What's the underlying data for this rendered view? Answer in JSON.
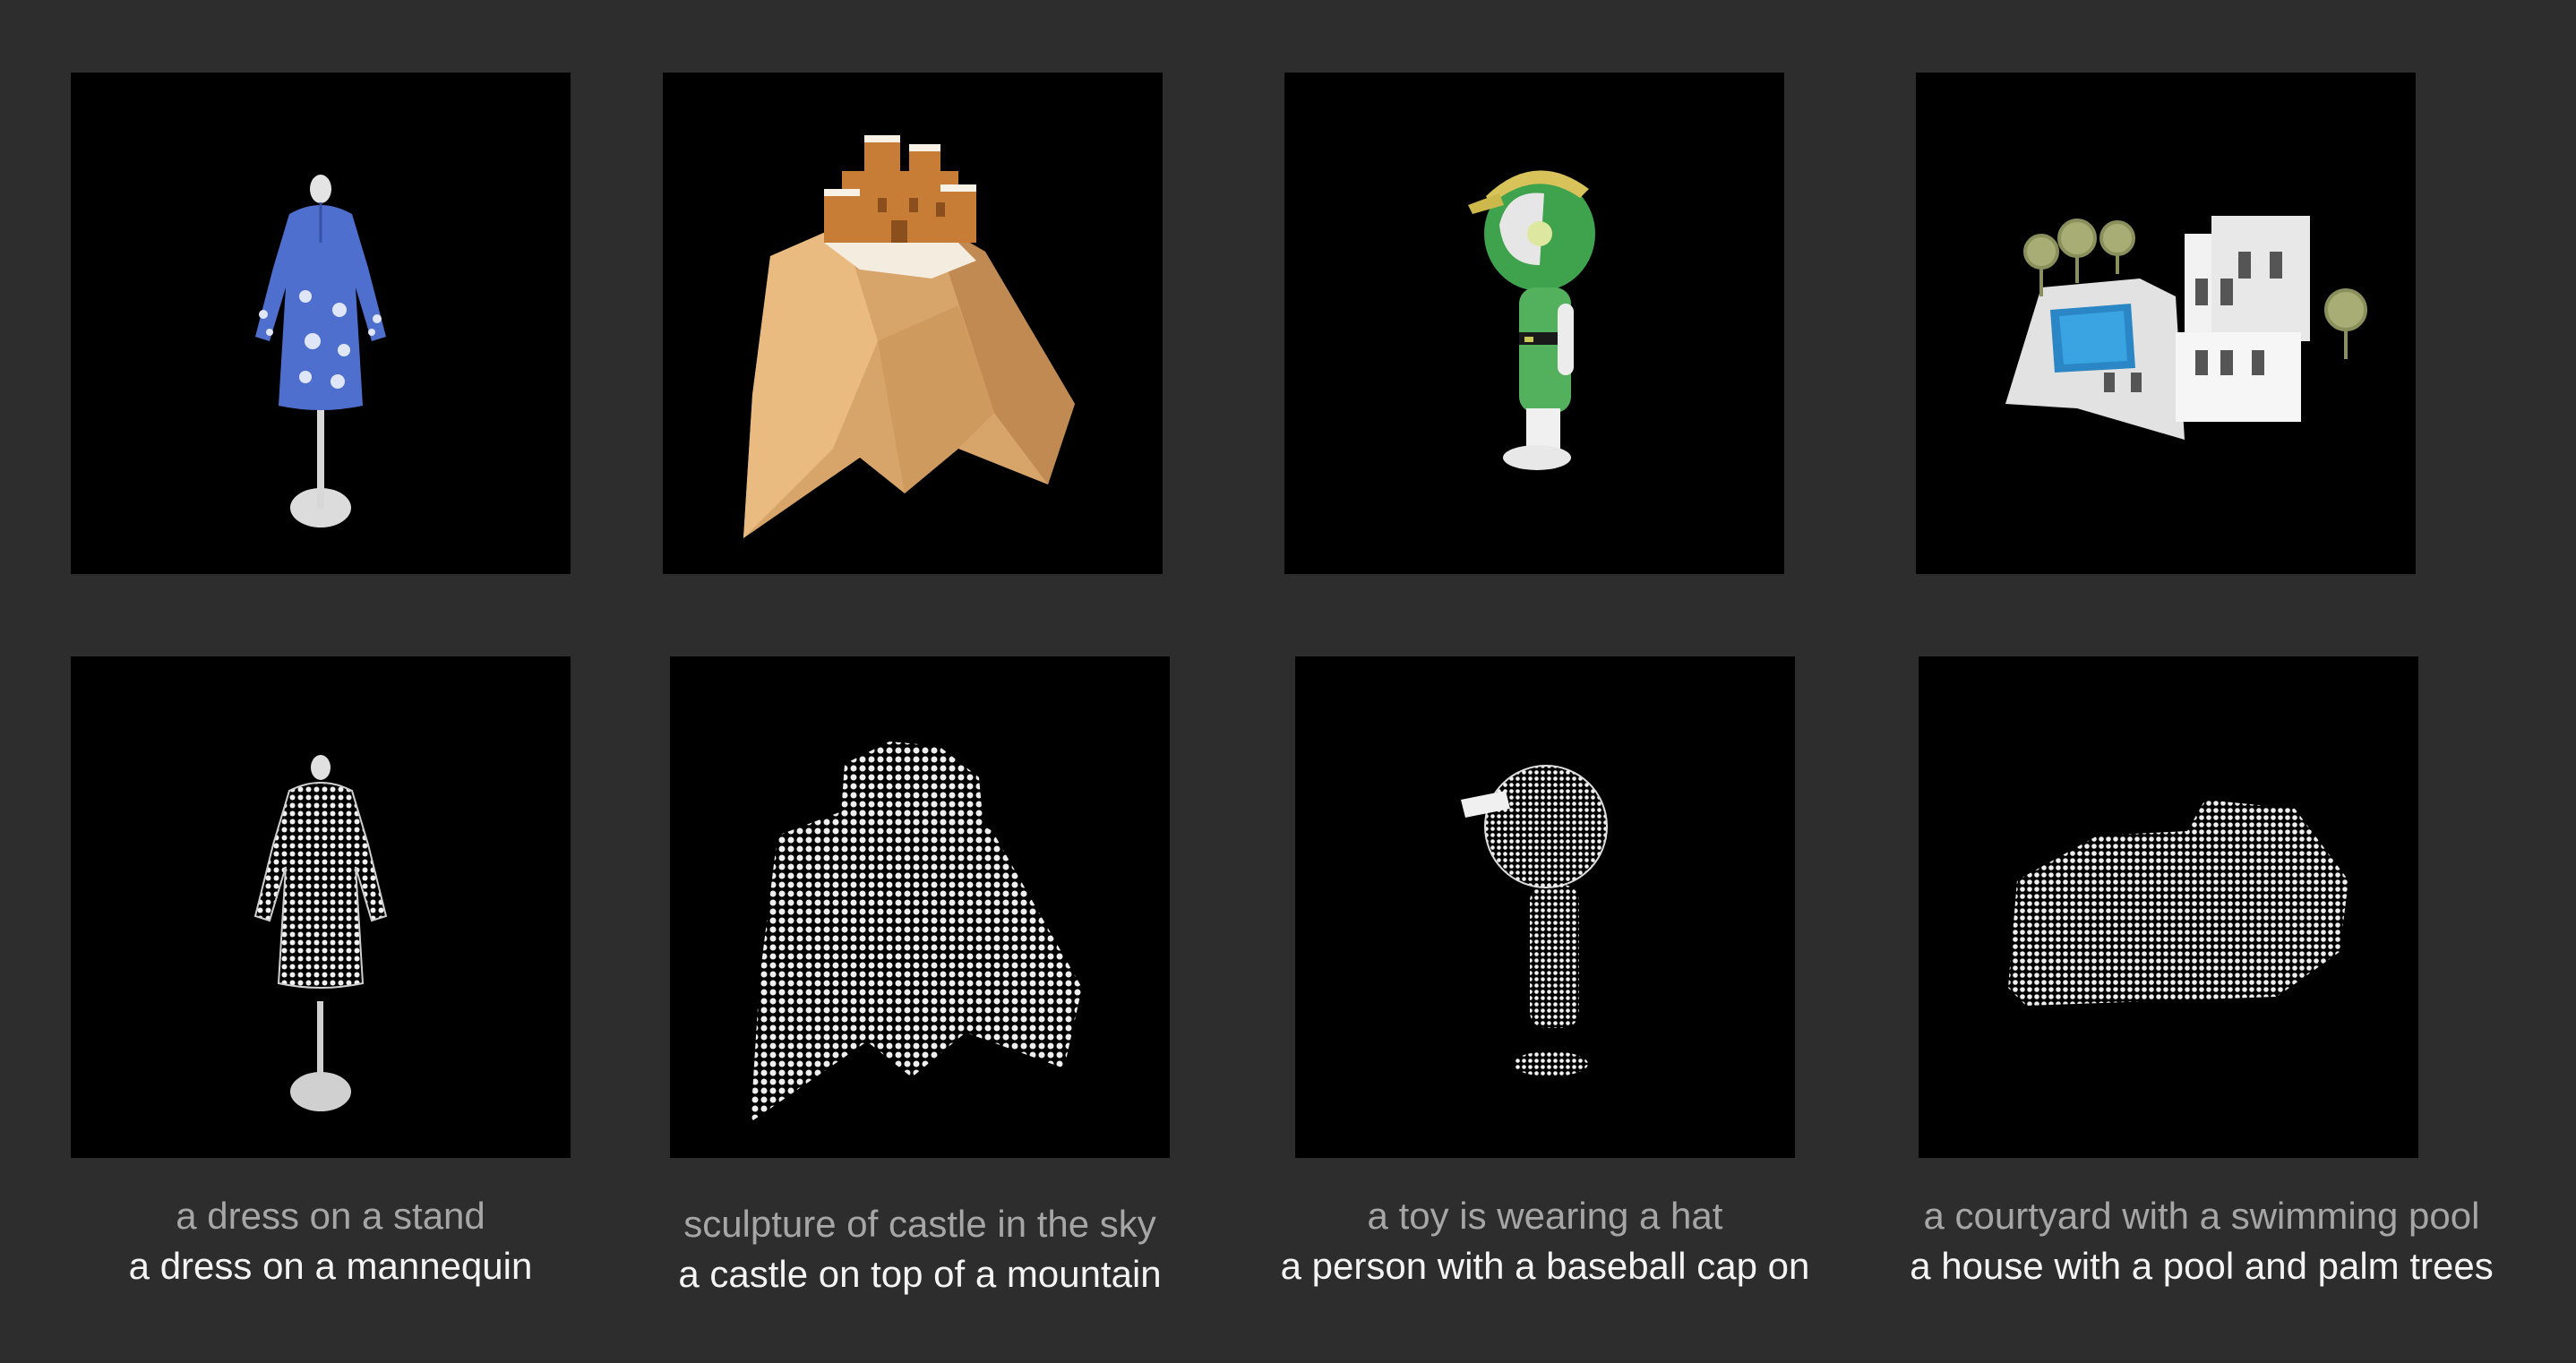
{
  "colors": {
    "background": "#2d2d2d",
    "panel": "#000000",
    "caption_secondary": "#a6a6a6",
    "caption_primary": "#f4f4f4"
  },
  "columns": [
    {
      "mesh_render": "blue dress on a white mannequin stand",
      "point_cloud_render": "white point cloud of dress on stand",
      "caption_top": "a dress on a stand",
      "caption_bottom": "a dress on a mannequin"
    },
    {
      "mesh_render": "sandy castle on top of a rocky mountain",
      "point_cloud_render": "white point cloud of castle on mountain",
      "caption_top": "sculpture of castle in the sky",
      "caption_bottom": "a castle on top of a mountain"
    },
    {
      "mesh_render": "green toy figure wearing a yellow cap",
      "point_cloud_render": "white point cloud of figure with cap",
      "caption_top": "a toy is wearing a hat",
      "caption_bottom": "a person with a baseball cap on"
    },
    {
      "mesh_render": "white house with blue pool and palm trees",
      "point_cloud_render": "white point cloud of house with pool",
      "caption_top": "a courtyard with a swimming pool",
      "caption_bottom": "a house with a pool and palm trees"
    }
  ]
}
